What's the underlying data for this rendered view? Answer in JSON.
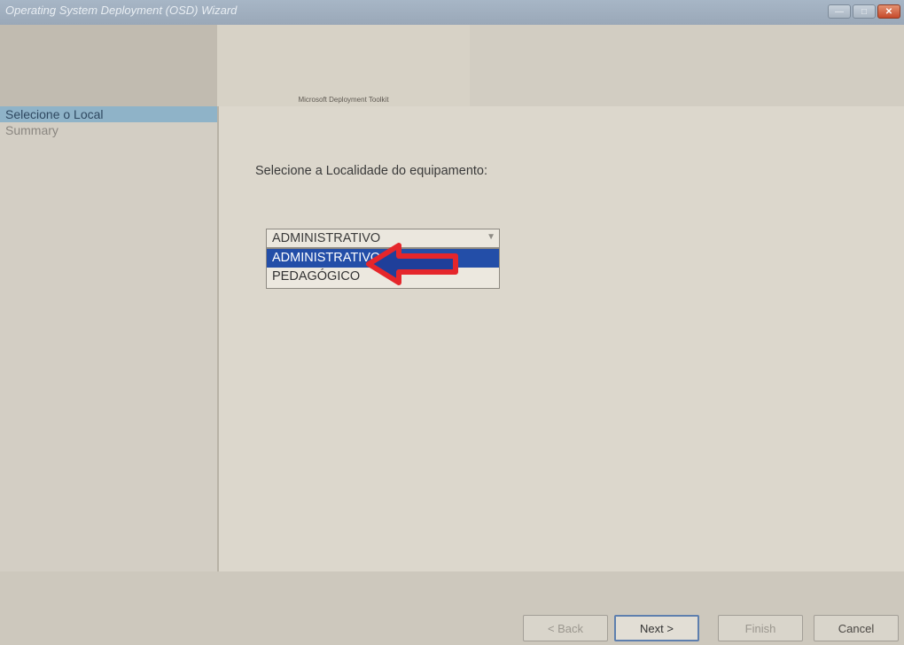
{
  "window": {
    "title": "Operating System Deployment (OSD) Wizard",
    "controls": {
      "minimize": "—",
      "maximize": "□",
      "close": "✕"
    }
  },
  "banner": {
    "text": "Microsoft Deployment Toolkit"
  },
  "sidebar": {
    "items": [
      {
        "label": "Selecione o Local",
        "active": true
      },
      {
        "label": "Summary",
        "active": false
      }
    ]
  },
  "main": {
    "prompt": "Selecione a Localidade do equipamento:",
    "combo": {
      "value": "ADMINISTRATIVO",
      "options": [
        {
          "label": "ADMINISTRATIVO",
          "selected": true
        },
        {
          "label": "PEDAGÓGICO",
          "selected": false
        }
      ]
    },
    "annotation_color": "#e5262b"
  },
  "footer": {
    "back": "< Back",
    "next": "Next >",
    "finish": "Finish",
    "cancel": "Cancel"
  }
}
